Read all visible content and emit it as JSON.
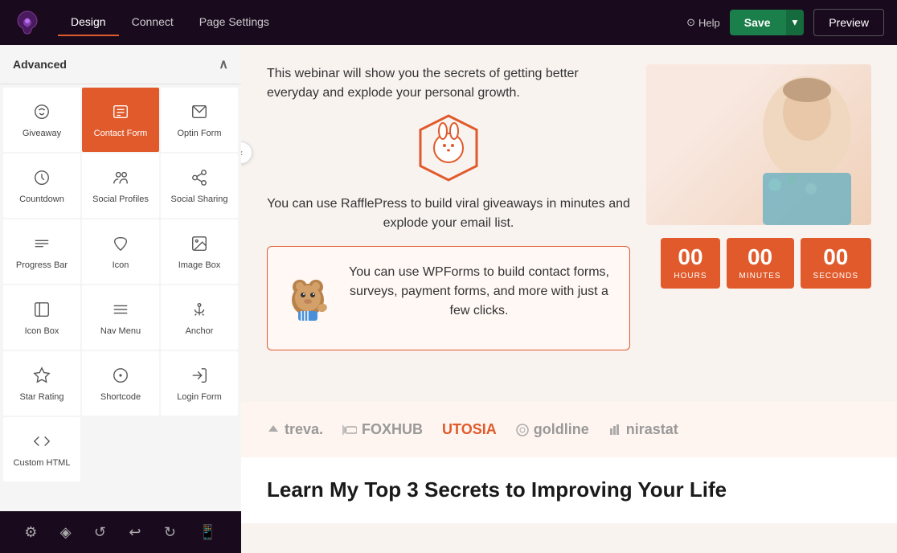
{
  "topNav": {
    "tabs": [
      {
        "id": "design",
        "label": "Design",
        "active": true
      },
      {
        "id": "connect",
        "label": "Connect",
        "active": false
      },
      {
        "id": "page-settings",
        "label": "Page Settings",
        "active": false
      }
    ],
    "helpLabel": "Help",
    "saveLabel": "Save",
    "previewLabel": "Preview"
  },
  "sidebar": {
    "sectionLabel": "Advanced",
    "widgets": [
      {
        "id": "giveaway",
        "label": "Giveaway",
        "icon": "🎁",
        "active": false
      },
      {
        "id": "contact-form",
        "label": "Contact Form",
        "icon": "📋",
        "active": true
      },
      {
        "id": "optin-form",
        "label": "Optin Form",
        "icon": "✉️",
        "active": false
      },
      {
        "id": "countdown",
        "label": "Countdown",
        "icon": "⏱",
        "active": false
      },
      {
        "id": "social-profiles",
        "label": "Social Profiles",
        "icon": "👥",
        "active": false
      },
      {
        "id": "social-sharing",
        "label": "Social Sharing",
        "icon": "⬆️",
        "active": false
      },
      {
        "id": "progress-bar",
        "label": "Progress Bar",
        "icon": "≡",
        "active": false
      },
      {
        "id": "icon",
        "label": "Icon",
        "icon": "♡",
        "active": false
      },
      {
        "id": "image-box",
        "label": "Image Box",
        "icon": "🖼",
        "active": false
      },
      {
        "id": "icon-box",
        "label": "Icon Box",
        "icon": "□",
        "active": false
      },
      {
        "id": "nav-menu",
        "label": "Nav Menu",
        "icon": "☰",
        "active": false
      },
      {
        "id": "anchor",
        "label": "Anchor",
        "icon": "⚓",
        "active": false
      },
      {
        "id": "star-rating",
        "label": "Star Rating",
        "icon": "☆",
        "active": false
      },
      {
        "id": "shortcode",
        "label": "Shortcode",
        "icon": "⊕",
        "active": false
      },
      {
        "id": "login-form",
        "label": "Login Form",
        "icon": "→",
        "active": false
      },
      {
        "id": "custom-html",
        "label": "Custom HTML",
        "icon": "</>",
        "active": false
      }
    ]
  },
  "bottomToolbar": {
    "icons": [
      "⚙",
      "◈",
      "↺",
      "↩",
      "↻",
      "📱"
    ]
  },
  "content": {
    "introText": "This webinar will show you the secrets of getting better everyday and explode your personal growth.",
    "raffleSubtext": "You can use RafflePress to build viral giveaways in minutes and explode your email list.",
    "wpformsText": "You can use WPForms to build contact forms, surveys, payment forms, and more with just a few clicks.",
    "countdown": {
      "hours": "00",
      "minutes": "00",
      "seconds": "00",
      "hoursLabel": "HOURS",
      "minutesLabel": "MINUTES",
      "secondsLabel": "SECONDS"
    },
    "logos": [
      "treva.",
      "FOXHUB",
      "UTOSIA",
      "goldline",
      "nirastat"
    ],
    "learnTitle": "Learn My Top 3 Secrets to Improving Your Life"
  },
  "colors": {
    "accent": "#e05a2b",
    "navBg": "#1a0a1e",
    "saveGreen": "#1a7f4b"
  }
}
